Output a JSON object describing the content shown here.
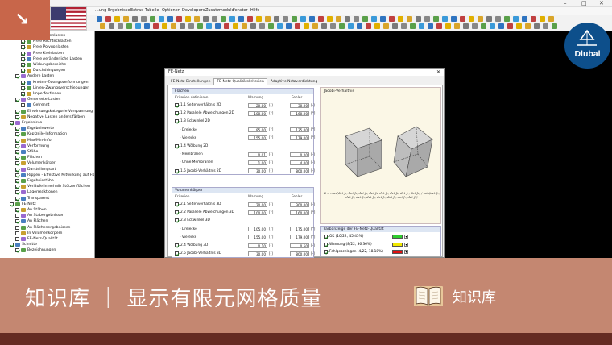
{
  "app": {
    "menu": [
      "...ung",
      "Ergebnisse",
      "Extras",
      "Tabelle",
      "Optionen",
      "Developers",
      "Zusatzmodule",
      "Fenster",
      "Hilfe"
    ],
    "window_controls": [
      "–",
      "□",
      "✕"
    ]
  },
  "navigator": {
    "rows": [
      {
        "label": "Freie Linienlasten",
        "indent": 2,
        "checked": true
      },
      {
        "label": "Freie Rechtecklasten",
        "indent": 2,
        "checked": true
      },
      {
        "label": "Freie Polygonlasten",
        "indent": 2,
        "checked": true
      },
      {
        "label": "Freie Kreislasten",
        "indent": 2,
        "checked": true
      },
      {
        "label": "Freie veränderliche Lasten",
        "indent": 2,
        "checked": true
      },
      {
        "label": "Wirkungsbereiche",
        "indent": 2,
        "checked": true
      },
      {
        "label": "Durchdringungen",
        "indent": 2,
        "checked": true
      },
      {
        "label": "Andere Lasten",
        "indent": 1,
        "checked": true
      },
      {
        "label": "Knoten-Zwangsverformungen",
        "indent": 2,
        "checked": true
      },
      {
        "label": "Linien-Zwangsverschiebungen",
        "indent": 2,
        "checked": true
      },
      {
        "label": "Imperfektionen",
        "indent": 2,
        "checked": true
      },
      {
        "label": "Generierte Lasten",
        "indent": 1,
        "checked": true
      },
      {
        "label": "Getrennt",
        "indent": 2,
        "checked": false
      },
      {
        "label": "Einwirkungskategorie Vorspannung",
        "indent": 1,
        "checked": true
      },
      {
        "label": "Negative Lasten anders färben",
        "indent": 1,
        "checked": true
      },
      {
        "label": "Ergebnisse",
        "indent": 0,
        "checked": true
      },
      {
        "label": "Ergebniswerte",
        "indent": 1,
        "checked": true
      },
      {
        "label": "Kopfzeile-Information",
        "indent": 1,
        "checked": true
      },
      {
        "label": "Max/Min-Info",
        "indent": 1,
        "checked": true
      },
      {
        "label": "Verformung",
        "indent": 1,
        "checked": true
      },
      {
        "label": "Stäbe",
        "indent": 1,
        "checked": true
      },
      {
        "label": "Flächen",
        "indent": 1,
        "checked": true
      },
      {
        "label": "Volumenkörper",
        "indent": 1,
        "checked": true
      },
      {
        "label": "Darstellungsart",
        "indent": 1,
        "checked": true
      },
      {
        "label": "Rippen - Effektive Mitwirkung auf Flä",
        "indent": 1,
        "checked": true
      },
      {
        "label": "Ergebnisstäbe",
        "indent": 1,
        "checked": true
      },
      {
        "label": "Verläufe innerhalb Stützenflächen",
        "indent": 1,
        "checked": true
      },
      {
        "label": "Lagerreaktionen",
        "indent": 1,
        "checked": true
      },
      {
        "label": "Transparent",
        "indent": 1,
        "checked": true
      },
      {
        "label": "FE-Netz",
        "indent": 0,
        "checked": true
      },
      {
        "label": "An Stäben",
        "indent": 1,
        "checked": true
      },
      {
        "label": "An Stabergebnissen",
        "indent": 1,
        "checked": false
      },
      {
        "label": "An Flächen",
        "indent": 1,
        "checked": true
      },
      {
        "label": "An Flächenergebnissen",
        "indent": 1,
        "checked": false
      },
      {
        "label": "In Volumenkörpern",
        "indent": 1,
        "checked": false
      },
      {
        "label": "FE-Netz-Qualität",
        "indent": 1,
        "checked": false
      },
      {
        "label": "Schnitte",
        "indent": 0,
        "checked": true
      },
      {
        "label": "Bezeichnungen",
        "indent": 1,
        "checked": true
      }
    ]
  },
  "dialog": {
    "title": "FE-Netz",
    "tabs": [
      "FE-Netz-Einstellungen",
      "FE-Netz-Qualitätskriterien",
      "Adaptive Netzverdichtung"
    ],
    "flaechen": {
      "title": "Flächen",
      "col_criteria": "Kriterien definieren:",
      "col_warn": "Warnung",
      "col_error": "Fehler",
      "rows": [
        {
          "label": "1.1 Seitenverhältnis 2D",
          "warn": "20.00",
          "err": "30.00",
          "unit": "[-]",
          "checked": true,
          "sub": false
        },
        {
          "label": "1.2 Parallele Abweichungen 2D",
          "warn": "100.00",
          "err": "160.00",
          "unit": "[°]",
          "checked": true,
          "sub": false
        },
        {
          "label": "1.3 Eckwinkel 2D",
          "warn": "",
          "err": "",
          "unit": "",
          "checked": true,
          "sub": false
        },
        {
          "label": "- Dreiecke",
          "warn": "95.00",
          "err": "135.00",
          "unit": "[°]",
          "checked": false,
          "sub": true
        },
        {
          "label": "- Vierecke",
          "warn": "155.00",
          "err": "179.00",
          "unit": "[°]",
          "checked": false,
          "sub": true
        },
        {
          "label": "1.4 Wölbung 2D",
          "warn": "",
          "err": "",
          "unit": "",
          "checked": true,
          "sub": false
        },
        {
          "label": "- Membranen",
          "warn": "0.01",
          "err": "0.20",
          "unit": "[-]",
          "checked": false,
          "sub": true
        },
        {
          "label": "- Ohne Membranen",
          "warn": "1.00",
          "err": "4.00",
          "unit": "[-]",
          "checked": false,
          "sub": true
        },
        {
          "label": "1.5 Jacobi-Verhältnis 2D",
          "warn": "30.00",
          "err": "800.00",
          "unit": "[-]",
          "checked": true,
          "sub": false
        }
      ]
    },
    "volumen": {
      "title": "Volumenkörper",
      "col_criteria": "Kriterien",
      "col_warn": "Warnung",
      "col_error": "Fehler",
      "rows": [
        {
          "label": "2.1 Seitenverhältnis 3D",
          "warn": "20.00",
          "err": "300.00",
          "unit": "[-]",
          "checked": true,
          "sub": false
        },
        {
          "label": "2.2 Parallele Abweichungen 3D",
          "warn": "100.00",
          "err": "160.00",
          "unit": "[°]",
          "checked": true,
          "sub": false
        },
        {
          "label": "2.3 Eckwinkel 3D",
          "warn": "",
          "err": "",
          "unit": "",
          "checked": true,
          "sub": false
        },
        {
          "label": "- Dreiecke",
          "warn": "105.00",
          "err": "175.00",
          "unit": "[°]",
          "checked": false,
          "sub": true
        },
        {
          "label": "- Vierecke",
          "warn": "155.00",
          "err": "179.00",
          "unit": "[°]",
          "checked": false,
          "sub": true
        },
        {
          "label": "2.4 Wölbung 3D",
          "warn": "0.10",
          "err": "0.50",
          "unit": "[-]",
          "checked": true,
          "sub": false
        },
        {
          "label": "2.5 Jacobi-Verhältnis 3D",
          "warn": "30.00",
          "err": "800.00",
          "unit": "[-]",
          "checked": true,
          "sub": false
        }
      ]
    },
    "preview": {
      "title": "Jacobi-Verhältnis",
      "formula": "R = max(det J₁, det J₂, det J₃, det J₄, det J₅, det J₆, det J₇, det J₈) / min(det J₁, det J₂, det J₃, det J₄, det J₅, det J₆, det J₇, det J₈)"
    },
    "quality": {
      "title": "Farbanzeige der FE-Netz-Qualität",
      "rows": [
        {
          "label": "OK (10/22, 45.45%)",
          "color": "#2ecc2e"
        },
        {
          "label": "Warnung (8/22, 36.36%)",
          "color": "#f0e800"
        },
        {
          "label": "Fehlgeschlagen (4/22, 18.18%)",
          "color": "#e01010"
        }
      ]
    }
  },
  "overlay": {
    "brand": "Dlubal",
    "banner_title": "知识库 ｜ 显示有限元网格质量",
    "banner_label": "知识库",
    "colors": {
      "corner": "#c8664a",
      "banner": "#c48771",
      "badge": "#0d4f8b",
      "bottom": "#652b22"
    }
  }
}
